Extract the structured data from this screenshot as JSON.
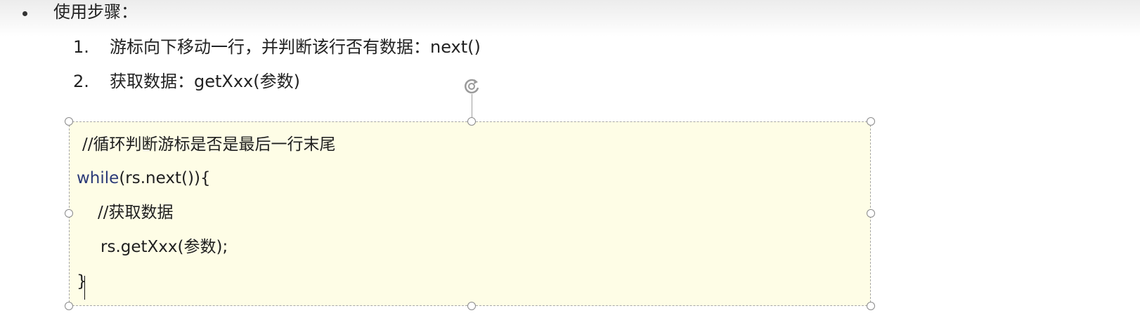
{
  "heading": "使用步骤：",
  "steps": [
    {
      "num": "1.",
      "text": "游标向下移动一行，并判断该行否有数据：next()"
    },
    {
      "num": "2.",
      "text": "获取数据：getXxx(参数)"
    }
  ],
  "code": {
    "comment1": "//循环判断游标是否是最后一行末尾",
    "while_keyword": "while",
    "while_rest": "(rs.next()){",
    "comment2": "//获取数据",
    "call": "rs.getXxx(参数);",
    "close": "}"
  },
  "colors": {
    "box_fill": "#fefde6",
    "keyword": "#2b3a78"
  },
  "icons": {
    "bullet": "bullet-dot-icon",
    "rotate": "rotate-handle-icon",
    "resize": "resize-handle-icon"
  }
}
